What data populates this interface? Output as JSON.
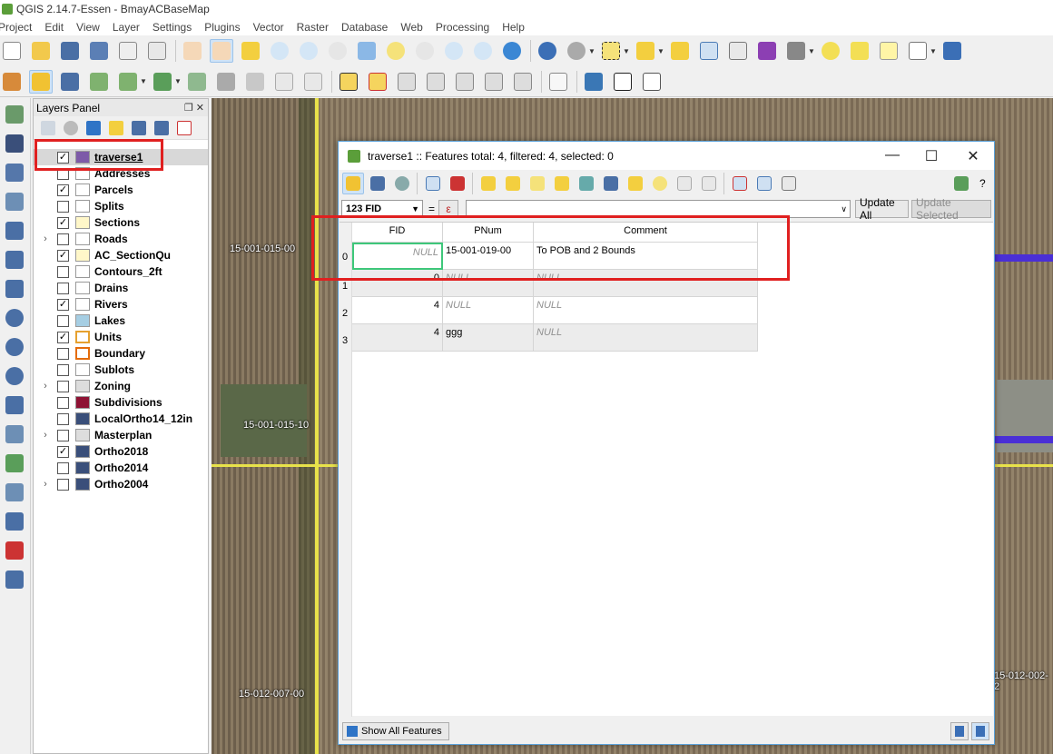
{
  "window": {
    "title": "QGIS 2.14.7-Essen - BmayACBaseMap"
  },
  "menu": [
    "Project",
    "Edit",
    "View",
    "Layer",
    "Settings",
    "Plugins",
    "Vector",
    "Raster",
    "Database",
    "Web",
    "Processing",
    "Help"
  ],
  "layers_panel": {
    "title": "Layers Panel",
    "layers": [
      {
        "name": "traverse1",
        "checked": true,
        "expandable": false,
        "selected": true,
        "symbol": "line-purple"
      },
      {
        "name": "Addresses",
        "checked": false,
        "expandable": false
      },
      {
        "name": "Parcels",
        "checked": true,
        "expandable": false
      },
      {
        "name": "Splits",
        "checked": false,
        "expandable": false
      },
      {
        "name": "Sections",
        "checked": true,
        "expandable": false
      },
      {
        "name": "Roads",
        "checked": false,
        "expandable": true
      },
      {
        "name": "AC_SectionQu",
        "checked": true,
        "expandable": false
      },
      {
        "name": "Contours_2ft",
        "checked": false,
        "expandable": false
      },
      {
        "name": "Drains",
        "checked": false,
        "expandable": false
      },
      {
        "name": "Rivers",
        "checked": true,
        "expandable": false
      },
      {
        "name": "Lakes",
        "checked": false,
        "expandable": false
      },
      {
        "name": "Units",
        "checked": true,
        "expandable": false
      },
      {
        "name": "Boundary",
        "checked": false,
        "expandable": false
      },
      {
        "name": "Sublots",
        "checked": false,
        "expandable": false
      },
      {
        "name": "Zoning",
        "checked": false,
        "expandable": true
      },
      {
        "name": "Subdivisions",
        "checked": false,
        "expandable": false
      },
      {
        "name": "LocalOrtho14_12in",
        "checked": false,
        "expandable": false
      },
      {
        "name": "Masterplan",
        "checked": false,
        "expandable": true
      },
      {
        "name": "Ortho2018",
        "checked": true,
        "expandable": false
      },
      {
        "name": "Ortho2014",
        "checked": false,
        "expandable": false
      },
      {
        "name": "Ortho2004",
        "checked": false,
        "expandable": true
      }
    ]
  },
  "map": {
    "labels": [
      "15-001-015-00",
      "15-001-015-10",
      "15-012-007-00",
      "15-012-002-2"
    ]
  },
  "attribute_table": {
    "title": "traverse1 :: Features total: 4, filtered: 4, selected: 0",
    "field_combo": "123 FID",
    "equals": "=",
    "update_all": "Update All",
    "update_selected": "Update Selected",
    "columns": [
      "FID",
      "PNum",
      "Comment"
    ],
    "rows": [
      {
        "num": "0",
        "fid": "NULL",
        "pnum": "15-001-019-00",
        "comment": "To POB and 2 Bounds"
      },
      {
        "num": "1",
        "fid": "0",
        "pnum": "NULL",
        "comment": "NULL"
      },
      {
        "num": "2",
        "fid": "4",
        "pnum": "NULL",
        "comment": "NULL"
      },
      {
        "num": "3",
        "fid": "4",
        "pnum": "ggg",
        "comment": "NULL"
      }
    ],
    "show_all": "Show All Features",
    "help": "?"
  }
}
